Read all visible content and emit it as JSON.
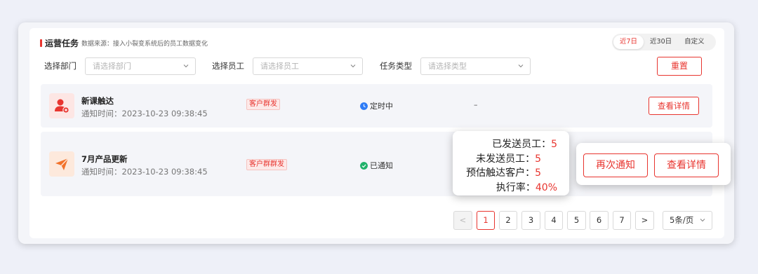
{
  "header": {
    "title": "运营任务",
    "subtitle": "数据来源：接入小裂变系统后的员工数据变化",
    "range_tabs": [
      "近7日",
      "近30日",
      "自定义"
    ],
    "active_range": "近7日"
  },
  "filters": {
    "department": {
      "label": "选择部门",
      "placeholder": "请选择部门"
    },
    "employee": {
      "label": "选择员工",
      "placeholder": "请选择员工"
    },
    "task_type": {
      "label": "任务类型",
      "placeholder": "请选择类型"
    },
    "reset_label": "重置"
  },
  "tasks": [
    {
      "name": "新课触达",
      "time": "通知时间：2023-10-23 09:38:45",
      "tag": "客户群发",
      "status": "定时中",
      "status_color": "#2f7cf6",
      "extra": "–",
      "detail_label": "查看详情",
      "icon": "user-add-icon",
      "icon_color": "#e8352f"
    },
    {
      "name": "7月产品更新",
      "time": "通知时间：2023-10-23 09:38:45",
      "tag": "客户群群发",
      "status": "已通知",
      "status_color": "#20b26b",
      "icon": "paper-plane-icon",
      "icon_color": "#f2722a"
    }
  ],
  "stats_tooltip": {
    "sent": {
      "label": "已发送员工：",
      "value": "5"
    },
    "unsent": {
      "label": "未发送员工：",
      "value": "5"
    },
    "reach": {
      "label": "预估触达客户：",
      "value": "5"
    },
    "rate": {
      "label": "执行率：",
      "value": "40%"
    }
  },
  "action_popover": {
    "renotify_label": "再次通知",
    "detail_label": "查看详情"
  },
  "pagination": {
    "prev": "<",
    "pages": [
      "1",
      "2",
      "3",
      "4",
      "5",
      "6",
      "7"
    ],
    "current": "1",
    "next": ">",
    "page_size": "5条/页"
  },
  "colors": {
    "accent": "#e8352f"
  }
}
